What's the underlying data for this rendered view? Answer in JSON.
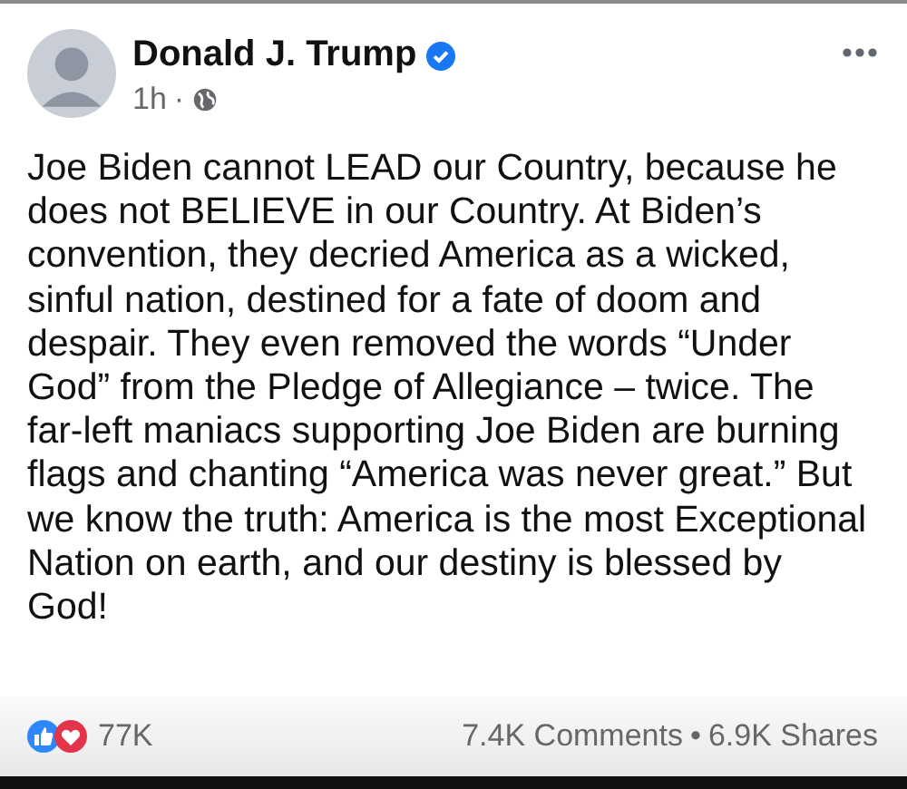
{
  "post": {
    "author": "Donald J. Trump",
    "verified": true,
    "time": "1h",
    "separator": "·",
    "text": "Joe Biden cannot LEAD our Country, because he does not BELIEVE in our Country. At Biden’s convention, they decried America as a wicked, sinful nation, destined for a fate of doom and despair. They even removed the words “Under God” from the Pledge of Allegiance – twice. The far-left maniacs supporting Joe Biden are burning flags and chanting “America was never great.” But we know the truth: America is the most Exceptional Nation on earth, and our destiny is blessed by God!"
  },
  "footer": {
    "reactions": "77K",
    "comments": "7.4K Comments",
    "separator": "•",
    "shares": "6.9K Shares"
  }
}
